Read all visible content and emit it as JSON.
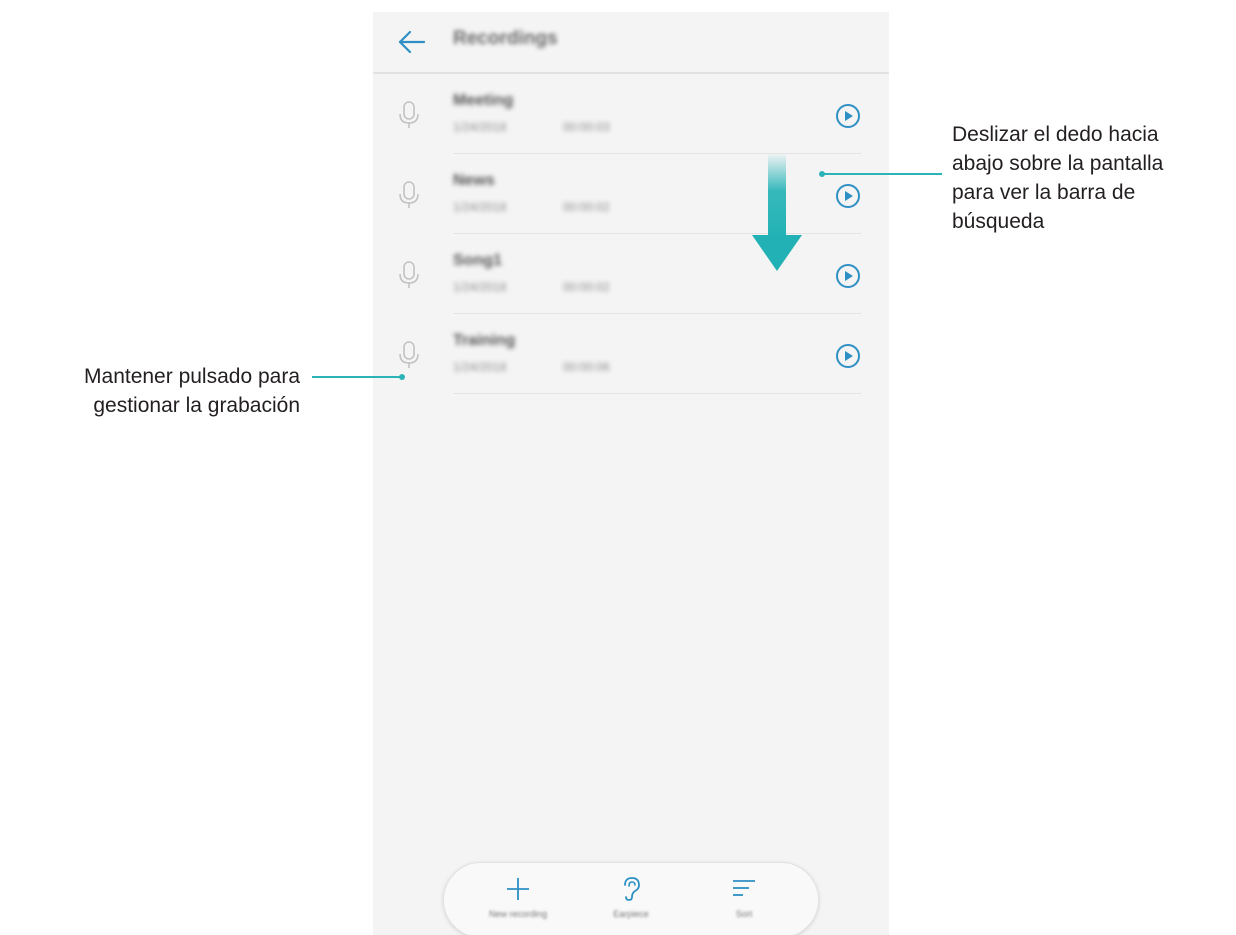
{
  "app_bar": {
    "title": "Recordings",
    "back_icon": "arrow-left-icon"
  },
  "recordings": [
    {
      "name": "Meeting",
      "date": "1/24/2018",
      "duration": "00:00:03"
    },
    {
      "name": "News",
      "date": "1/24/2018",
      "duration": "00:00:02"
    },
    {
      "name": "Song1",
      "date": "1/24/2018",
      "duration": "00:00:02"
    },
    {
      "name": "Training",
      "date": "1/24/2018",
      "duration": "00:00:06"
    }
  ],
  "bottom_actions": [
    {
      "label": "New recording",
      "icon": "plus-icon"
    },
    {
      "label": "Earpiece",
      "icon": "ear-icon"
    },
    {
      "label": "Sort",
      "icon": "sort-icon"
    }
  ],
  "callouts": {
    "swipe_down": "Deslizar el dedo hacia\nabajo sobre la pantalla\npara ver la barra de\nbúsqueda",
    "long_press": "Mantener pulsado para\ngestionar la grabación"
  },
  "colors": {
    "accent": "#2e8fc4",
    "callout_line": "#2bb3b8",
    "arrow": "#22b2b5"
  }
}
